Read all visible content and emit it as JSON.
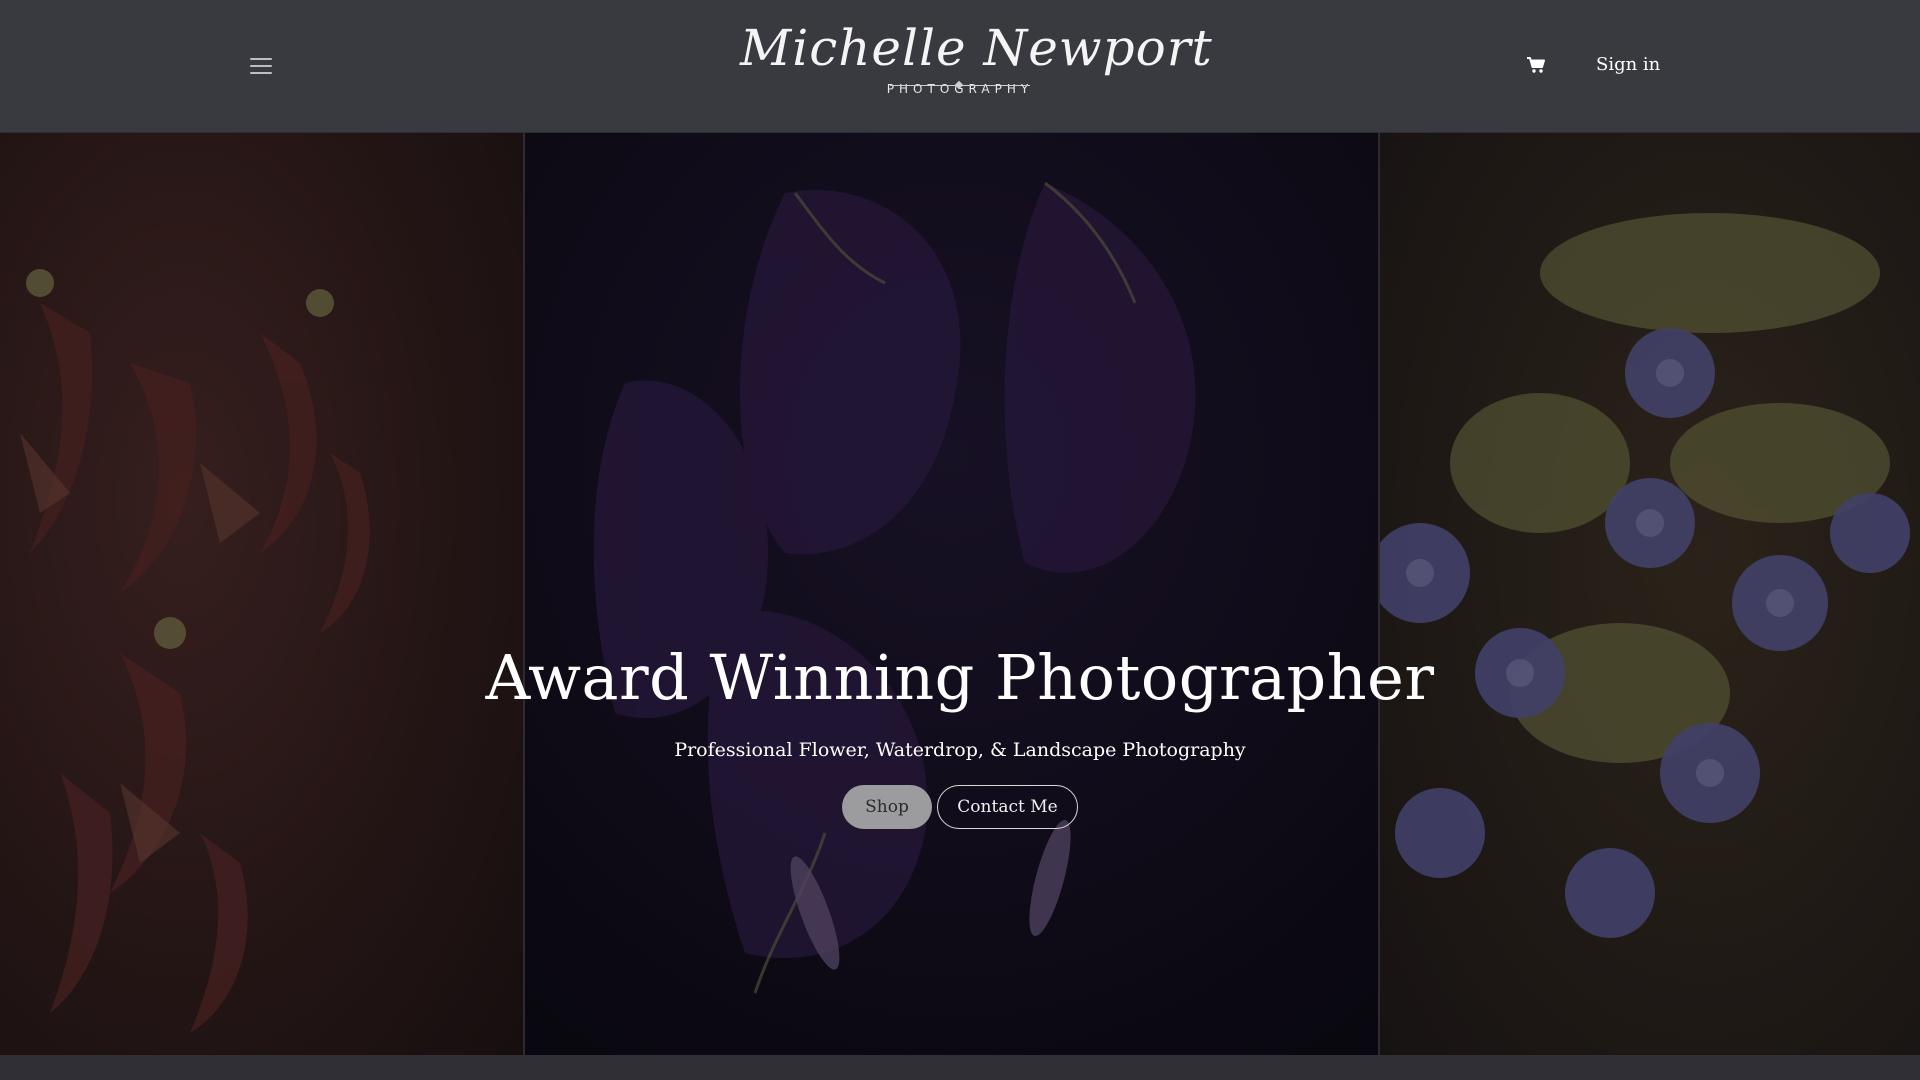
{
  "header": {
    "logo_script": "Michelle Newport",
    "logo_sub": "PHOTOGRAPHY",
    "menu_icon": "hamburger-icon",
    "cart_icon": "cart-icon",
    "signin_label": "Sign in"
  },
  "hero": {
    "title": "Award Winning Photographer",
    "subtitle": "Professional Flower, Waterdrop, & Landscape Photography",
    "shop_label": "Shop",
    "contact_label": "Contact Me"
  },
  "colors": {
    "header_bg": "#393940",
    "shop_button_bg": "#9c9c9f",
    "text": "#ffffff"
  }
}
